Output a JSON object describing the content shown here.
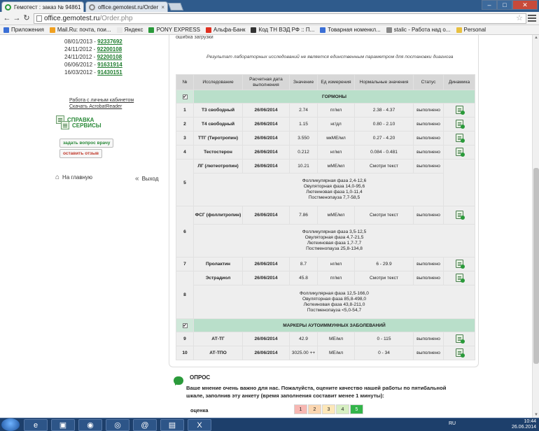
{
  "browser": {
    "tabs": [
      {
        "title": "Гемотест : заказ № 94861",
        "close": "×"
      },
      {
        "title": "office.gemotest.ru/Order",
        "close": "×"
      }
    ],
    "window_buttons": {
      "minimize": "–",
      "maximize": "□",
      "close": "✕"
    },
    "url_host": "office.gemotest.ru",
    "url_path": "/Order.php",
    "bookmarks": [
      {
        "label": "Приложения",
        "color": "#3b6fd6"
      },
      {
        "label": "Mail.Ru: почта, пои...",
        "color": "#f0a020"
      },
      {
        "label": "Яндекс",
        "color": "#e8e8e8"
      },
      {
        "label": "PONY EXPRESS",
        "color": "#2a9a3a"
      },
      {
        "label": "Альфа-Банк",
        "color": "#e03020"
      },
      {
        "label": "Код ТН ВЭД РФ :: П...",
        "color": "#333333"
      },
      {
        "label": "Товарная номенкл...",
        "color": "#3b6fd6"
      },
      {
        "label": "stalic - Работа над о...",
        "color": "#888888"
      },
      {
        "label": "Personal",
        "color": "#e8c040"
      }
    ]
  },
  "sidebar": {
    "orders": [
      {
        "date": "08/01/2013 - ",
        "num": "92337692"
      },
      {
        "date": "24/11/2012 - ",
        "num": "92200108"
      },
      {
        "date": "24/11/2012 - ",
        "num": "92200108"
      },
      {
        "date": "06/06/2012 - ",
        "num": "91631914"
      },
      {
        "date": "16/03/2012 - ",
        "num": "91430151"
      }
    ],
    "help_title": "СПРАВКА",
    "help_links": [
      "Работа с личным кабинетом",
      "Скачать AcrobatReader"
    ],
    "services_title": "СЕРВИСЫ",
    "ask_doctor": "задать вопрос врачу",
    "leave_review": "оставить отзыв",
    "home": "На главную",
    "exit": "Выход"
  },
  "main": {
    "load_error": "ошибка загрузки",
    "disclaimer": "Результат лабораторных исследований не является единственным параметром для постановки диагноза",
    "headers": [
      "№",
      "Исследование",
      "Расчетная дата выполнения",
      "Значение",
      "Ед измерения",
      "Нормальные значения",
      "Статус",
      "Динамика"
    ],
    "group1": "ГОРМОНЫ",
    "group2": "МАРКЕРЫ АУТОИММУННЫХ ЗАБОЛЕВАНИЙ",
    "check": "✔",
    "rows1": [
      {
        "n": "1",
        "name": "Т3 свободный",
        "date": "26/06/2014",
        "val": "2.74",
        "unit": "пг/мл",
        "norm": "2.38 - 4.37",
        "status": "выполнено"
      },
      {
        "n": "2",
        "name": "Т4 свободный",
        "date": "26/06/2014",
        "val": "1.15",
        "unit": "нг/дл",
        "norm": "0.80 - 2.10",
        "status": "выполнено"
      },
      {
        "n": "3",
        "name": "ТТГ (Тиротропин)",
        "date": "26/06/2014",
        "val": "3.550",
        "unit": "мкМЕ/мл",
        "norm": "0.27 - 4.20",
        "status": "выполнено"
      },
      {
        "n": "4",
        "name": "Тестостерон",
        "date": "26/06/2014",
        "val": "0.212",
        "unit": "нг/мл",
        "norm": "0.084 - 0.481",
        "status": "выполнено"
      }
    ],
    "row5": {
      "n": "5",
      "name": "ЛГ (лютеотропин)",
      "date": "26/06/2014",
      "val": "10.21",
      "unit": "мМЕ/мл",
      "norm": "Смотри текст",
      "status": "выполнено",
      "notes": [
        "Фолликулярная фаза 2,4-12,6",
        "Овуляторная фаза 14,0-95,6",
        "Лютеиновая фаза 1,0-11,4",
        "Постменопауза 7,7-58,5"
      ]
    },
    "row6": {
      "n": "6",
      "name": "ФСГ (фоллитропин)",
      "date": "26/06/2014",
      "val": "7.86",
      "unit": "мМЕ/мл",
      "norm": "Смотри текст",
      "status": "выполнено",
      "notes": [
        "Фолликулярная фаза 3,5-12,5",
        "Овуляторная фаза 4,7-21,5",
        "Лютеиновая фаза 1,7-7,7",
        "Постменопауза 25,8-134,8"
      ]
    },
    "row7": {
      "n": "7",
      "name": "Пролактин",
      "date": "26/06/2014",
      "val": "8.7",
      "unit": "нг/мл",
      "norm": "6 - 29.9",
      "status": "выполнено"
    },
    "row8": {
      "n": "8",
      "name": "Эстрадиол",
      "date": "26/06/2014",
      "val": "45.8",
      "unit": "пг/мл",
      "norm": "Смотри текст",
      "status": "выполнено",
      "notes": [
        "Фолликулярная фаза 12,5-166,0",
        "Овуляторная фаза 85,8-498,0",
        "Лютеиновая фаза 43,8-211,0",
        "Постменопауза <5,0-54,7"
      ]
    },
    "rows2": [
      {
        "n": "9",
        "name": "АТ-ТГ",
        "date": "26/06/2014",
        "val": "42.9",
        "unit": "МЕ/мл",
        "norm": "0 - 115",
        "status": "выполнено"
      },
      {
        "n": "10",
        "name": "АТ-ТПО",
        "date": "26/06/2014",
        "val": "3025.00 ++",
        "unit": "МЕ/мл",
        "norm": "0 - 34",
        "status": "выполнено"
      }
    ]
  },
  "survey": {
    "title": "ОПРОС",
    "text": "Ваше мнение очень важно для нас. Пожалуйста, оцените качество нашей работы по пятибальной шкале, заполнив эту анкету (время заполнения составит менее 1 минуты):",
    "rating_label": "оценка",
    "ratings": [
      "1",
      "2",
      "3",
      "4",
      "5"
    ],
    "rating_colors": [
      "#f7b7b2",
      "#fbd6b0",
      "#fde7b8",
      "#d6efc1",
      "#33b54a"
    ]
  },
  "taskbar": {
    "lang": "RU",
    "time": "10:44",
    "date": "26.06.2014",
    "apps": [
      "e",
      "▣",
      "◉",
      "◎",
      "@",
      "▤",
      "X"
    ]
  }
}
